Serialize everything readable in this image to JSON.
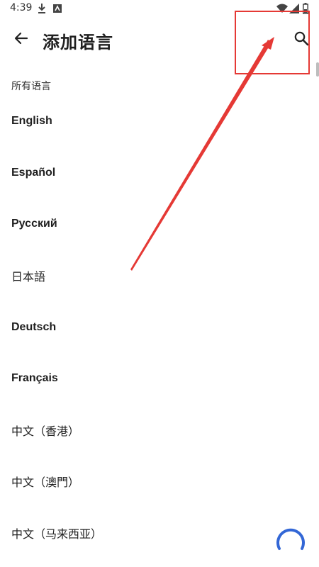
{
  "status_bar": {
    "time": "4:39"
  },
  "app_bar": {
    "title": "添加语言",
    "back_icon": "arrow-back-icon",
    "search_icon": "search-icon"
  },
  "section": {
    "header": "所有语言"
  },
  "languages": [
    {
      "label": "English"
    },
    {
      "label": "Español"
    },
    {
      "label": "Русский"
    },
    {
      "label": "日本語"
    },
    {
      "label": "Deutsch"
    },
    {
      "label": "Français"
    },
    {
      "label": "中文（香港）"
    },
    {
      "label": "中文（澳門）"
    },
    {
      "label": "中文（马来西亚）"
    }
  ],
  "colors": {
    "annotation": "#e53935",
    "spinner": "#3367d6"
  }
}
